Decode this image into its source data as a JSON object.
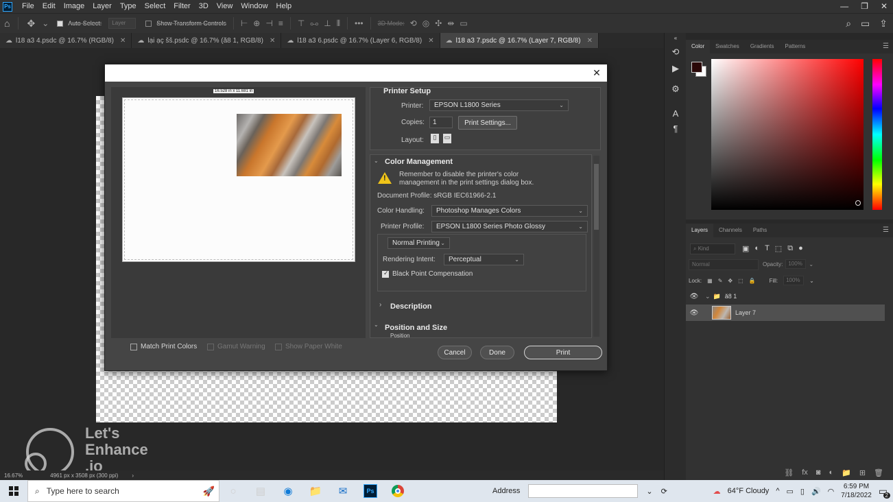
{
  "menubar": {
    "logo": "Ps",
    "items": [
      "File",
      "Edit",
      "Image",
      "Layer",
      "Type",
      "Select",
      "Filter",
      "3D",
      "View",
      "Window",
      "Help"
    ],
    "controls": [
      "—",
      "❐",
      "✕"
    ]
  },
  "options_bar": {
    "auto_select_label": "Auto-Select:",
    "auto_select_value": "Layer",
    "transform_label": "Show Transform Controls",
    "mode_3d_label": "3D Mode:"
  },
  "doc_tabs": [
    {
      "label": "l18 a3 4.psdc @ 16.7% (RGB/8)"
    },
    {
      "label": "lại ạç šš.psdc @ 16.7% (ă8 1, RGB/8)"
    },
    {
      "label": "l18 a3 6.psdc @ 16.7% (Layer 6, RGB/8)"
    },
    {
      "label": "l18 a3 7.psdc @ 16.7% (Layer 7, RGB/8)"
    }
  ],
  "watermark": {
    "line1": "Let's",
    "line2": "Enhance",
    "line3": ".io"
  },
  "status_bar": {
    "zoom": "16.67%",
    "doc_size": "4961 px x 3508 px (300 ppi)"
  },
  "color_panel": {
    "tabs": [
      "Color",
      "Swatches",
      "Gradients",
      "Patterns"
    ],
    "foreground": "#2a0808",
    "background": "#ffffff"
  },
  "layers_panel": {
    "tabs": [
      "Layers",
      "Channels",
      "Paths"
    ],
    "kind_placeholder": "Kind",
    "blend_mode": "Normal",
    "opacity_label": "Opacity:",
    "opacity_value": "100%",
    "lock_label": "Lock:",
    "fill_label": "Fill:",
    "fill_value": "100%",
    "group_name": "ă8 1",
    "layer_name": "Layer 7"
  },
  "print_dialog": {
    "preview_dims": "16.528 in x 11.681 in",
    "match_print_colors": "Match Print Colors",
    "gamut_warning": "Gamut Warning",
    "show_paper_white": "Show Paper White",
    "printer_setup": {
      "title": "Printer Setup",
      "printer_label": "Printer:",
      "printer_value": "EPSON L1800 Series",
      "copies_label": "Copies:",
      "copies_value": "1",
      "print_settings_button": "Print Settings...",
      "layout_label": "Layout:"
    },
    "color_management": {
      "title": "Color Management",
      "warning_line1": "Remember to disable the printer's color",
      "warning_line2": "management in the print settings dialog box.",
      "document_profile": "Document Profile: sRGB IEC61966-2.1",
      "color_handling_label": "Color Handling:",
      "color_handling_value": "Photoshop Manages Colors",
      "printer_profile_label": "Printer Profile:",
      "printer_profile_value": "EPSON L1800 Series Photo Glossy",
      "printing_mode": "Normal Printing",
      "rendering_intent_label": "Rendering Intent:",
      "rendering_intent_value": "Perceptual",
      "black_point_label": "Black Point Compensation"
    },
    "description_title": "Description",
    "position_title": "Position and Size",
    "position_sub": "Position",
    "buttons": {
      "cancel": "Cancel",
      "done": "Done",
      "print": "Print"
    }
  },
  "taskbar": {
    "search_placeholder": "Type here to search",
    "address_label": "Address",
    "weather": "64°F  Cloudy",
    "time": "6:59 PM",
    "date": "7/18/2022",
    "notifications": "2"
  }
}
